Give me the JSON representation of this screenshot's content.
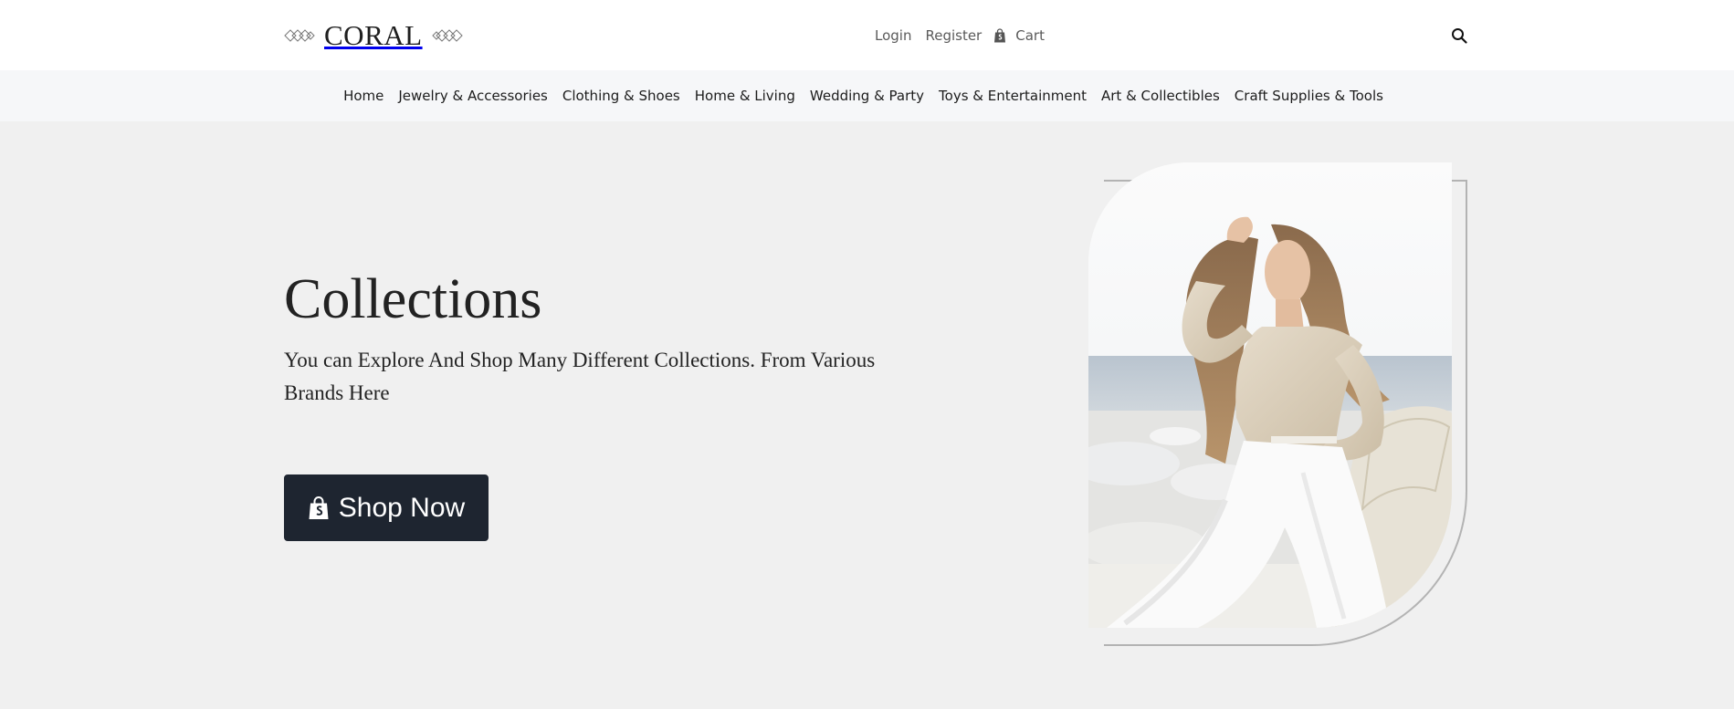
{
  "brand": {
    "name": "CORAL",
    "logo_icon": "diamond-lattice-ornament"
  },
  "header": {
    "login_label": "Login",
    "register_label": "Register",
    "cart_label": "Cart",
    "cart_icon": "shopping-bag-icon",
    "search_icon": "magnifier-icon"
  },
  "categories": [
    "Home",
    "Jewelry & Accessories",
    "Clothing & Shoes",
    "Home & Living",
    "Wedding & Party",
    "Toys & Entertainment",
    "Art & Collectibles",
    "Craft Supplies & Tools"
  ],
  "hero": {
    "title": "Collections",
    "subtitle": "You can Explore And Shop Many Different Collections. From Various Brands Here",
    "cta_label": "Shop Now",
    "cta_icon": "shopping-bag-icon"
  },
  "colors": {
    "header_bg": "#ffffff",
    "nav_bg": "#f6f7f9",
    "hero_bg": "#f0f0f0",
    "cta_bg": "#1e2530",
    "text_dark": "#222222",
    "text_muted": "#5a5a5a",
    "outline": "#b3b3b3"
  }
}
